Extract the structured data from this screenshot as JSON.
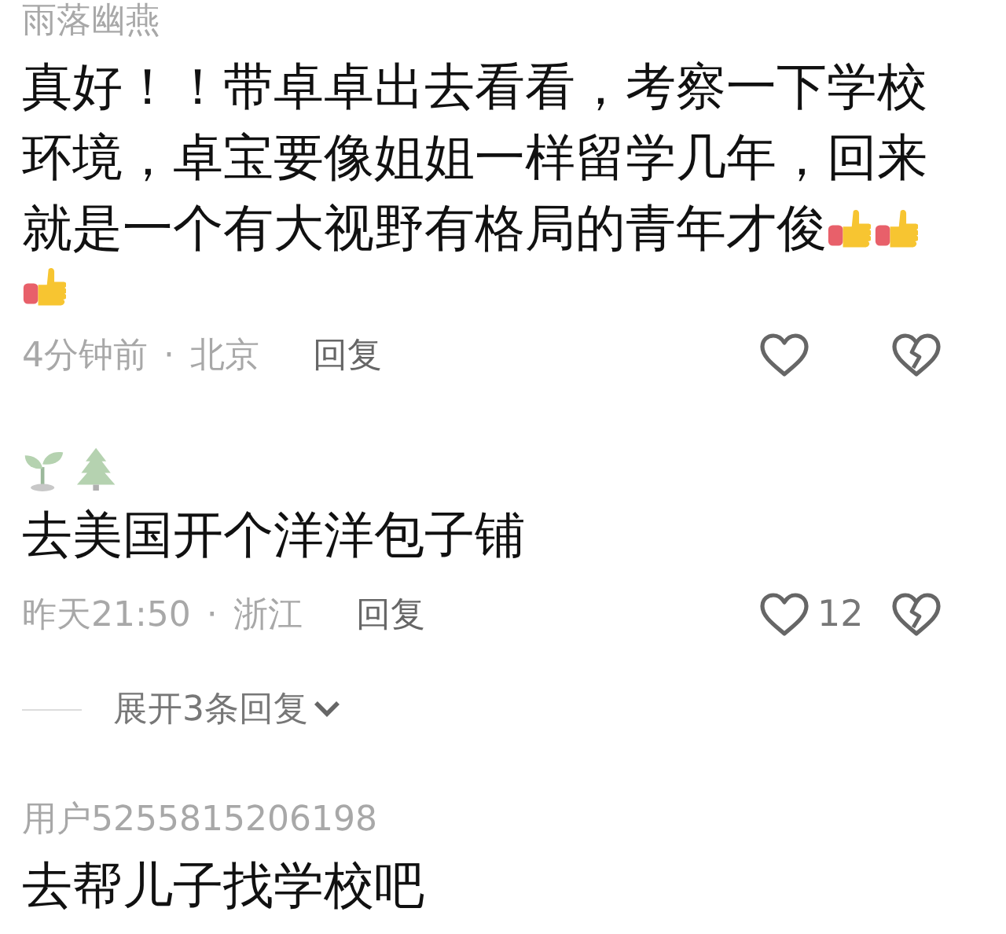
{
  "comments": [
    {
      "author": "雨落幽燕",
      "text_lines": [
        "真好！！带卓卓出去看看，考察一下学校",
        "环境，卓宝要像姐姐一样留学几年，回来",
        "就是一个有大视野有格局的青年才俊"
      ],
      "emoji": [
        {
          "kind": "thumbs_up"
        },
        {
          "kind": "thumbs_up"
        },
        {
          "kind": "thumbs_up"
        }
      ],
      "time": "4分钟前",
      "separator": "·",
      "location": "北京",
      "reply": "回复"
    },
    {
      "author_icons": [
        {
          "kind": "seedling"
        },
        {
          "kind": "tree"
        }
      ],
      "text_lines": [
        "去美国开个洋洋包子铺"
      ],
      "time": "昨天21:50",
      "separator": "·",
      "location": "浙江",
      "reply": "回复",
      "likes": "12",
      "expand": "展开3条回复"
    },
    {
      "author": "用户5255815206198",
      "text_lines": [
        "去帮儿子找学校吧"
      ]
    }
  ]
}
